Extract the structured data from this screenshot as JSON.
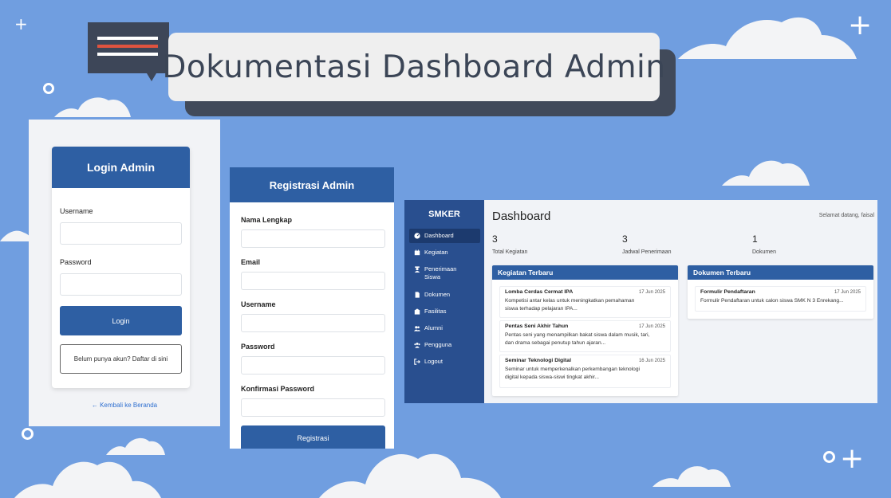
{
  "banner": {
    "title": "Dokumentasi Dashboard Admin",
    "icon": "chat-bubble-icon"
  },
  "colors": {
    "background": "#709ee0",
    "primary": "#2e5fa3",
    "sidebar": "#294f8f",
    "banner_shadow": "#414a5a"
  },
  "login": {
    "title": "Login Admin",
    "username_label": "Username",
    "password_label": "Password",
    "login_button": "Login",
    "register_button": "Belum punya akun? Daftar di sini",
    "back_link": "← Kembali ke Beranda"
  },
  "register": {
    "title": "Registrasi Admin",
    "fields": [
      "Nama Lengkap",
      "Email",
      "Username",
      "Password",
      "Konfirmasi Password"
    ],
    "submit": "Registrasi"
  },
  "dashboard": {
    "brand": "SMKER",
    "nav": [
      {
        "label": "Dashboard",
        "icon": "gauge-icon"
      },
      {
        "label": "Kegiatan",
        "icon": "calendar-icon"
      },
      {
        "label": "Penerimaan Siswa",
        "icon": "user-graduate-icon"
      },
      {
        "label": "Dokumen",
        "icon": "file-icon"
      },
      {
        "label": "Fasilitas",
        "icon": "building-icon"
      },
      {
        "label": "Alumni",
        "icon": "users-icon"
      },
      {
        "label": "Pengguna",
        "icon": "user-group-icon"
      },
      {
        "label": "Logout",
        "icon": "logout-icon"
      }
    ],
    "title": "Dashboard",
    "welcome": "Selamat datang, faisal",
    "stats": [
      {
        "value": "3",
        "label": "Total Kegiatan"
      },
      {
        "value": "3",
        "label": "Jadwal Penerimaan"
      },
      {
        "value": "1",
        "label": "Dokumen"
      }
    ],
    "kegiatan": {
      "title": "Kegiatan Terbaru",
      "items": [
        {
          "title": "Lomba Cerdas Cermat IPA",
          "date": "17 Jun 2025",
          "desc1": "Kompetisi antar kelas untuk meningkatkan pemahaman",
          "desc2": "siswa terhadap pelajaran IPA..."
        },
        {
          "title": "Pentas Seni Akhir Tahun",
          "date": "17 Jun 2025",
          "desc1": "Pentas seni yang menampilkan bakat siswa dalam musik, tari,",
          "desc2": "dan drama sebagai penutup tahun ajaran..."
        },
        {
          "title": "Seminar Teknologi Digital",
          "date": "16 Jun 2025",
          "desc1": "Seminar untuk memperkenalkan perkembangan teknologi",
          "desc2": "digital kepada siswa-siswi tingkat akhir..."
        }
      ]
    },
    "dokumen": {
      "title": "Dokumen Terbaru",
      "items": [
        {
          "title": "Formulir Pendaftaran",
          "date": "17 Jun 2025",
          "desc1": "Formulir Pendaftaran untuk calon siswa SMK N 3 Enrekang..."
        }
      ]
    }
  }
}
